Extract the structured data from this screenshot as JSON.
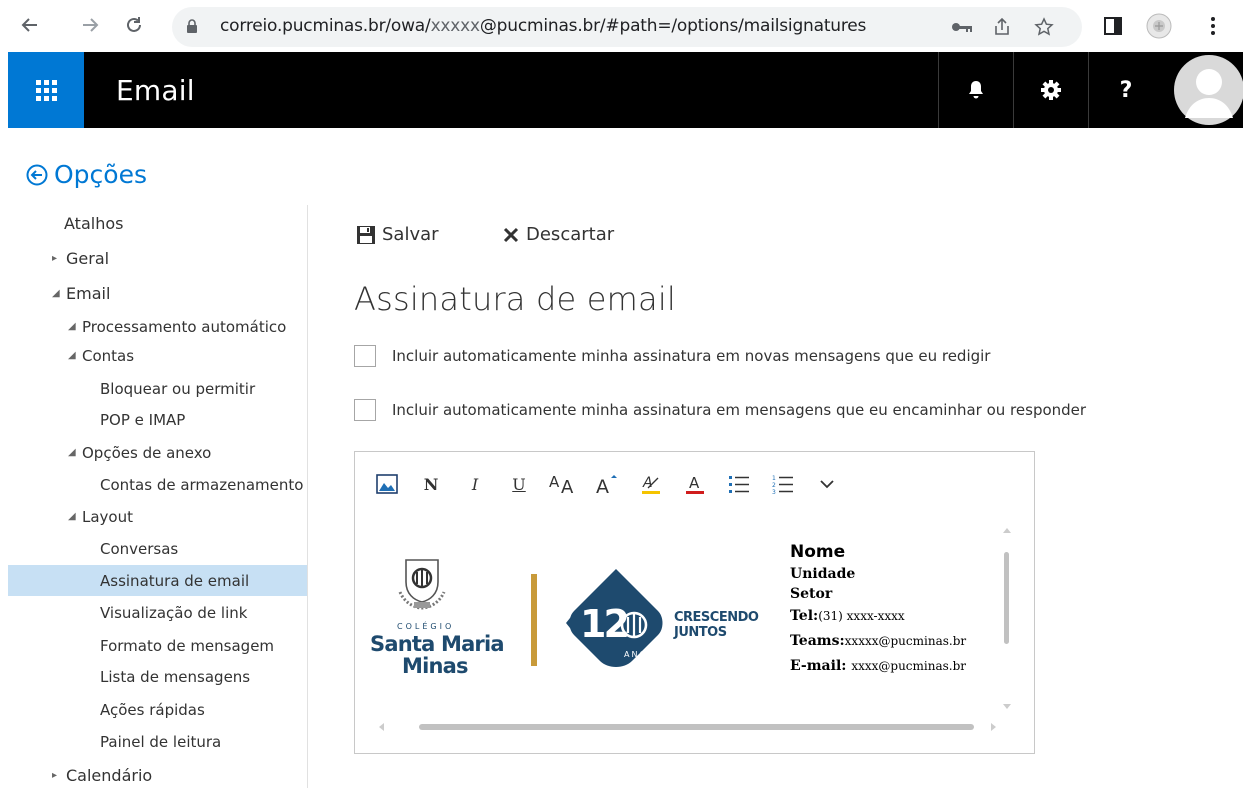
{
  "browser": {
    "url_host": "correio.pucminas.br/owa/",
    "url_user": "xxxxx",
    "url_rest": "@pucminas.br/#path=/options/mailsignatures"
  },
  "header": {
    "app_title": "Email",
    "accent": "#0078d4"
  },
  "options": {
    "title": "Opções"
  },
  "nav": {
    "items": [
      {
        "label": "Atalhos"
      },
      {
        "label": "Geral"
      },
      {
        "label": "Email"
      },
      {
        "label": "Processamento automático"
      },
      {
        "label": "Contas"
      },
      {
        "label": "Bloquear ou permitir"
      },
      {
        "label": "POP e IMAP"
      },
      {
        "label": "Opções de anexo"
      },
      {
        "label": "Contas de armazenamento"
      },
      {
        "label": "Layout"
      },
      {
        "label": "Conversas"
      },
      {
        "label": "Assinatura de email"
      },
      {
        "label": "Visualização de link"
      },
      {
        "label": "Formato de mensagem"
      },
      {
        "label": "Lista de mensagens"
      },
      {
        "label": "Ações rápidas"
      },
      {
        "label": "Painel de leitura"
      },
      {
        "label": "Calendário"
      }
    ]
  },
  "toolbar": {
    "save_label": "Salvar",
    "discard_label": "Descartar"
  },
  "page": {
    "title": "Assinatura de email",
    "checkbox_new": "Incluir automaticamente minha assinatura em novas mensagens que eu redigir",
    "checkbox_reply": "Incluir automaticamente minha assinatura em mensagens que eu encaminhar ou responder"
  },
  "format_toolbar": {
    "bold": "N",
    "italic": "I",
    "underline": "U"
  },
  "signature": {
    "college_small": "COLÉGIO",
    "college_line1": "Santa Maria",
    "college_line2": "Minas",
    "badge_number": "12",
    "badge_word": "ANOS",
    "slogan_line1": "CRESCENDO",
    "slogan_line2": "JUNTOS",
    "name": "Nome",
    "unit": "Unidade",
    "sector": "Setor",
    "tel_label": "Tel:",
    "tel_value": "(31) xxxx-xxxx",
    "teams_label": "Teams:",
    "teams_value": "xxxxx@pucminas.br",
    "email_label": "E-mail: ",
    "email_value": "xxxx@pucminas.br",
    "brand_color": "#1e4a6e"
  }
}
